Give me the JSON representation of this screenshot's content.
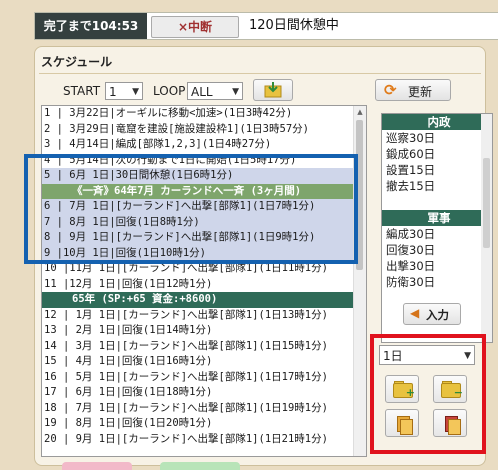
{
  "header": {
    "timer": "完了まで104:53",
    "stop_label": "×中断",
    "status": "120日間休憩中"
  },
  "schedule": {
    "title": "スケジュール",
    "start_label": "START",
    "start_value": "1",
    "loop_label": "LOOP",
    "loop_value": "ALL",
    "refresh_label": "更新",
    "rows": [
      {
        "text": "1  | 3月22日|オーギルに移動<加速>(1日3時42分)",
        "style": "normal"
      },
      {
        "text": "2  | 3月29日|竜窟を建設[施設建設枠1](1日3時57分)",
        "style": "normal"
      },
      {
        "text": "3  | 4月14日|編成[部隊1,2,3](1日4時27分)",
        "style": "normal"
      },
      {
        "text": "4  | 5月14日|次の行動まで1日に開始(1日5時17分)",
        "style": "normal"
      },
      {
        "text": "5  | 6月 1日|30日間休憩(1日6時1分)",
        "style": "sel"
      },
      {
        "text": "《一斉》64年7月 カーランドへ一斉 (3ヶ月間)",
        "style": "hdr-green"
      },
      {
        "text": "6  | 7月 1日|[カーランド]へ出撃[部隊1](1日7時1分)",
        "style": "sel"
      },
      {
        "text": "7  | 8月 1日|回復(1日8時1分)",
        "style": "sel"
      },
      {
        "text": "8  | 9月 1日|[カーランド]へ出撃[部隊1](1日9時1分)",
        "style": "sel"
      },
      {
        "text": "9  |10月 1日|回復(1日10時1分)",
        "style": "sel"
      },
      {
        "text": "10 |11月 1日|[カーランド]へ出撃[部隊1](1日11時1分)",
        "style": "normal"
      },
      {
        "text": "11 |12月 1日|回復(1日12時1分)",
        "style": "normal"
      },
      {
        "text": "65年  (SP:+65 資金:+8600)",
        "style": "hdr"
      },
      {
        "text": "12 | 1月 1日|[カーランド]へ出撃[部隊1](1日13時1分)",
        "style": "normal"
      },
      {
        "text": "13 | 2月 1日|回復(1日14時1分)",
        "style": "normal"
      },
      {
        "text": "14 | 3月 1日|[カーランド]へ出撃[部隊1](1日15時1分)",
        "style": "normal"
      },
      {
        "text": "15 | 4月 1日|回復(1日16時1分)",
        "style": "normal"
      },
      {
        "text": "16 | 5月 1日|[カーランド]へ出撃[部隊1](1日17時1分)",
        "style": "normal"
      },
      {
        "text": "17 | 6月 1日|回復(1日18時1分)",
        "style": "normal"
      },
      {
        "text": "18 | 7月 1日|[カーランド]へ出撃[部隊1](1日19時1分)",
        "style": "normal"
      },
      {
        "text": "19 | 8月 1日|回復(1日20時1分)",
        "style": "normal"
      },
      {
        "text": "20 | 9月 1日|[カーランド]へ出撃[部隊1](1日21時1分)",
        "style": "normal"
      }
    ]
  },
  "side_list": {
    "items": [
      {
        "text": "内政",
        "type": "cat"
      },
      {
        "text": "巡察30日",
        "type": "item"
      },
      {
        "text": "鍛成60日",
        "type": "item"
      },
      {
        "text": "設置15日",
        "type": "item"
      },
      {
        "text": "撤去15日",
        "type": "item"
      },
      {
        "text": "",
        "type": "item"
      },
      {
        "text": "軍事",
        "type": "cat"
      },
      {
        "text": "編成30日",
        "type": "item"
      },
      {
        "text": "回復30日",
        "type": "item"
      },
      {
        "text": "出撃30日",
        "type": "item"
      },
      {
        "text": "防衛30日",
        "type": "item"
      }
    ],
    "input_label": "入力"
  },
  "controls": {
    "days_value": "1日"
  },
  "colors": {
    "highlight_blue": "#1461b0",
    "highlight_red": "#e0121d",
    "accent_green": "#2f6b58"
  }
}
